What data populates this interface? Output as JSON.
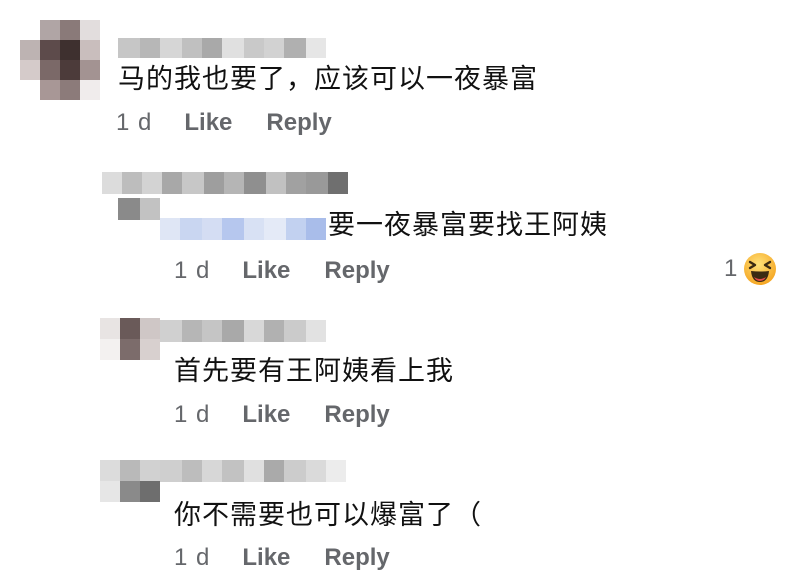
{
  "comments": [
    {
      "text": "马的我也要了，应该可以一夜暴富",
      "time": "1 d",
      "like_label": "Like",
      "reply_label": "Reply"
    },
    {
      "text": "要一夜暴富要找王阿姨",
      "time": "1 d",
      "like_label": "Like",
      "reply_label": "Reply",
      "reaction_count": "1",
      "reaction_icon": "laughing-emoji-icon"
    },
    {
      "text": "首先要有王阿姨看上我",
      "time": "1 d",
      "like_label": "Like",
      "reply_label": "Reply"
    },
    {
      "text": "你不需要也可以爆富了（",
      "time": "1 d",
      "like_label": "Like",
      "reply_label": "Reply"
    }
  ],
  "colors": {
    "meta_text": "#65676b",
    "body_text": "#111111",
    "reaction_yellow": "#f7b125"
  }
}
